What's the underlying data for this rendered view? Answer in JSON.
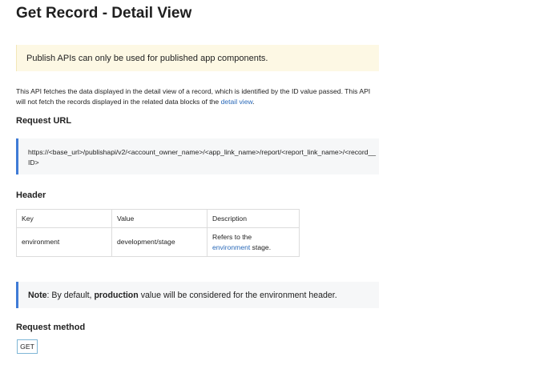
{
  "page_title": "Get Record - Detail View",
  "notice": "Publish APIs can only be used for published app components.",
  "description": {
    "text_before_link": "This API fetches the data displayed in the detail view of a record, which is identified by the ID value passed. This API will not fetch the records displayed in the related data blocks of the ",
    "link_text": "detail view",
    "text_after_link": "."
  },
  "request_url": {
    "heading": "Request URL",
    "url": "https://<base_url>/publishapi/v2/<account_owner_name>/<app_link_name>/report/<report_link_name>/<record__ID>"
  },
  "header": {
    "heading": "Header",
    "columns": [
      "Key",
      "Value",
      "Description"
    ],
    "rows": [
      {
        "key": "environment",
        "value": "development/stage",
        "description_prefix": "Refers to the",
        "description_link": "environment",
        "description_suffix": " stage."
      }
    ]
  },
  "note": {
    "label": "Note",
    "text_before": ": By default, ",
    "bold_word": "production",
    "text_after": " value will be considered for the environment header."
  },
  "request_method": {
    "heading": "Request method",
    "method": "GET"
  },
  "colors": {
    "link": "#2a69b8",
    "accent_border": "#3f7bd6",
    "notice_background": "#fdf8e4",
    "code_background": "#f6f7f8",
    "badge_border": "#7fb6d6"
  }
}
